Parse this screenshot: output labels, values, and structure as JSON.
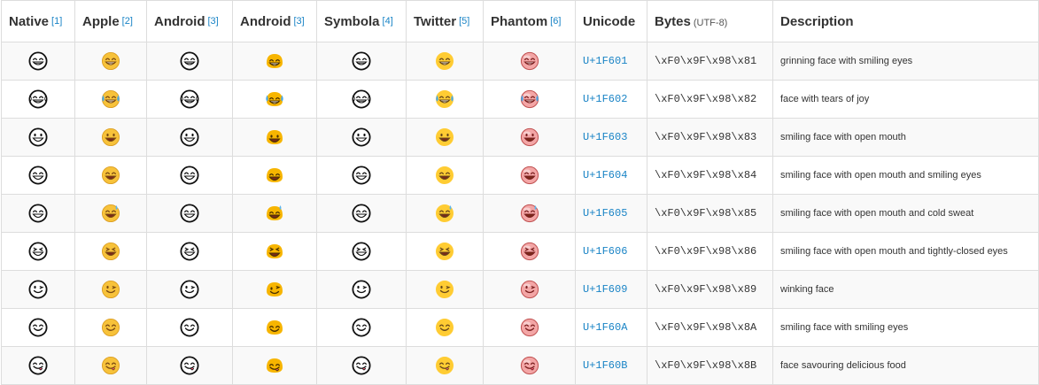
{
  "headers": {
    "native": {
      "label": "Native",
      "ref": "[1]"
    },
    "apple": {
      "label": "Apple",
      "ref": "[2]"
    },
    "android1": {
      "label": "Android",
      "ref": "[3]"
    },
    "android2": {
      "label": "Android",
      "ref": "[3]"
    },
    "symbola": {
      "label": "Symbola",
      "ref": "[4]"
    },
    "twitter": {
      "label": "Twitter",
      "ref": "[5]"
    },
    "phantom": {
      "label": "Phantom",
      "ref": "[6]"
    },
    "unicode": {
      "label": "Unicode"
    },
    "bytes": {
      "label": "Bytes",
      "note": "(UTF-8)"
    },
    "description": {
      "label": "Description"
    }
  },
  "rows": [
    {
      "code": "U+1F601",
      "bytes": "\\xF0\\x9F\\x98\\x81",
      "description": "grinning face with smiling eyes",
      "icon": "grinning-face-with-smiling-eyes"
    },
    {
      "code": "U+1F602",
      "bytes": "\\xF0\\x9F\\x98\\x82",
      "description": "face with tears of joy",
      "icon": "face-with-tears-of-joy"
    },
    {
      "code": "U+1F603",
      "bytes": "\\xF0\\x9F\\x98\\x83",
      "description": "smiling face with open mouth",
      "icon": "smiling-face-with-open-mouth"
    },
    {
      "code": "U+1F604",
      "bytes": "\\xF0\\x9F\\x98\\x84",
      "description": "smiling face with open mouth and smiling eyes",
      "icon": "smiling-face-open-mouth-smiling-eyes"
    },
    {
      "code": "U+1F605",
      "bytes": "\\xF0\\x9F\\x98\\x85",
      "description": "smiling face with open mouth and cold sweat",
      "icon": "smiling-face-cold-sweat"
    },
    {
      "code": "U+1F606",
      "bytes": "\\xF0\\x9F\\x98\\x86",
      "description": "smiling face with open mouth and tightly-closed eyes",
      "icon": "smiling-face-closed-eyes"
    },
    {
      "code": "U+1F609",
      "bytes": "\\xF0\\x9F\\x98\\x89",
      "description": "winking face",
      "icon": "winking-face"
    },
    {
      "code": "U+1F60A",
      "bytes": "\\xF0\\x9F\\x98\\x8A",
      "description": "smiling face with smiling eyes",
      "icon": "smiling-face-with-smiling-eyes"
    },
    {
      "code": "U+1F60B",
      "bytes": "\\xF0\\x9F\\x98\\x8B",
      "description": "face savouring delicious food",
      "icon": "face-savouring-food"
    }
  ],
  "colors": {
    "link": "#1a84c6",
    "border": "#dddddd",
    "stripe": "#f9f9f9",
    "apple_face": "#f7c23a",
    "android_face": "#f7b500",
    "twitter_face": "#ffcc33",
    "phantom_face": "#f3a6a6"
  }
}
